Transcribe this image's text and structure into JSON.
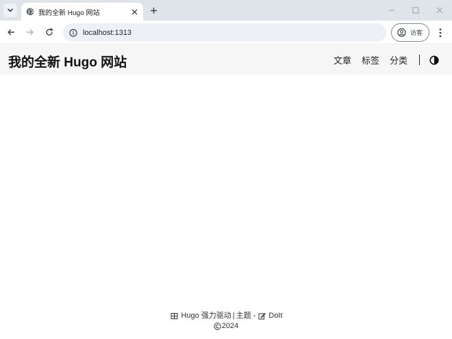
{
  "browser": {
    "tab_title": "我的全新 Hugo 网站",
    "url": "localhost:1313",
    "profile_label": "访客"
  },
  "site": {
    "logo": "我的全新 Hugo 网站",
    "menu": [
      {
        "label": "文章"
      },
      {
        "label": "标签"
      },
      {
        "label": "分类"
      }
    ]
  },
  "footer": {
    "powered_by": "Hugo 强力驱动",
    "separator": "|",
    "theme_prefix": "主题 -",
    "theme_name": "DoIt",
    "copyright": "2024"
  }
}
